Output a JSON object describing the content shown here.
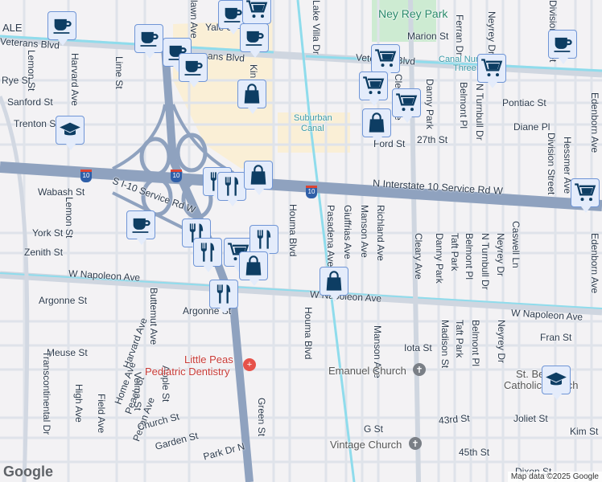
{
  "labels": [
    "ALE",
    "Veterans Blvd",
    "Harvard Ave",
    "Lemon St",
    "Lime St",
    "Rye St",
    "Sanford St",
    "Trenton St",
    "Yale St",
    "lawn Ave",
    "ans Blvd",
    "Kin",
    "Lake Villa Dr",
    "Ney Rey Park",
    "Marion St",
    "Veterans Blvd",
    "Canal Number",
    "Three",
    "Ferran Dr",
    "Neyrey Dr",
    "Division Street",
    "Hessmer Ave",
    "Edenborn Ave",
    "Pontiac St",
    "Diane Pl",
    "27th St",
    "Ford St",
    "Danny Park",
    "Belmont Pl",
    "N Turnbull Dr",
    "Suburban",
    "Canal",
    "Cleary Ave",
    "N Interstate 10 Service Rd W",
    "Wabash St",
    "S I-10 Service Rd W",
    "Lemon St",
    "York St",
    "Zenith St",
    "Houma Blvd",
    "Pasadena Ave",
    "Giuffrias Ave",
    "Manson Ave",
    "Richland Ave",
    "Danny Park",
    "Taft Park",
    "Belmont Pl",
    "N Turnbull Dr",
    "Neyrey Dr",
    "Caswell Ln",
    "Edenborn Ave",
    "W Napoleon Ave",
    "W Napoleon Ave",
    "W Napoleon Ave",
    "Argonne St",
    "Argonne St",
    "Meuse St",
    "Harvard Ave",
    "Buttemut Ave",
    "Home Ave",
    "Peach St",
    "Velma St",
    "Apple St",
    "Pecan Ave",
    "Field Ave",
    "High Ave",
    "Church St",
    "Garden St",
    "Park Dr N",
    "Transcontinental Dr",
    "Green St",
    "Houma Blvd",
    "Manson Ave",
    "Madison St",
    "Taft Park",
    "Belmont Pl",
    "Neyrey Dr",
    "Fran St",
    "Iota St",
    "Emanuel Church",
    "Little Peas",
    "Pediatric Dentistry",
    "St. Benilde",
    "Catholic Church",
    "43rd St",
    "Joliet St",
    "Kim St",
    "G St",
    "Vintage Church",
    "45th St",
    "Dixon St",
    "Division Street",
    "Cleary Ave"
  ],
  "shields": [
    "10",
    "10",
    "10"
  ],
  "markers": [
    "coffee",
    "coffee",
    "coffee",
    "coffee",
    "coffee",
    "cart",
    "coffee",
    "bag",
    "school",
    "cart",
    "cart",
    "cart",
    "bag",
    "cart",
    "coffee",
    "cart",
    "fork-knife",
    "fork-knife",
    "bag",
    "coffee",
    "fork-knife",
    "fork-knife",
    "cart",
    "fork-knife",
    "bag",
    "bag",
    "fork-knife",
    "school"
  ],
  "attribution": "Map data ©2025 Google",
  "logo": "Google",
  "colors": {
    "marker_fill": "#e4ecfb",
    "marker_border": "#6f95d6",
    "icon": "#0d3d63",
    "highway": "#8fa2bf",
    "canal": "#8fdcec",
    "commercial": "#faefd6",
    "park": "#cdebd2"
  }
}
